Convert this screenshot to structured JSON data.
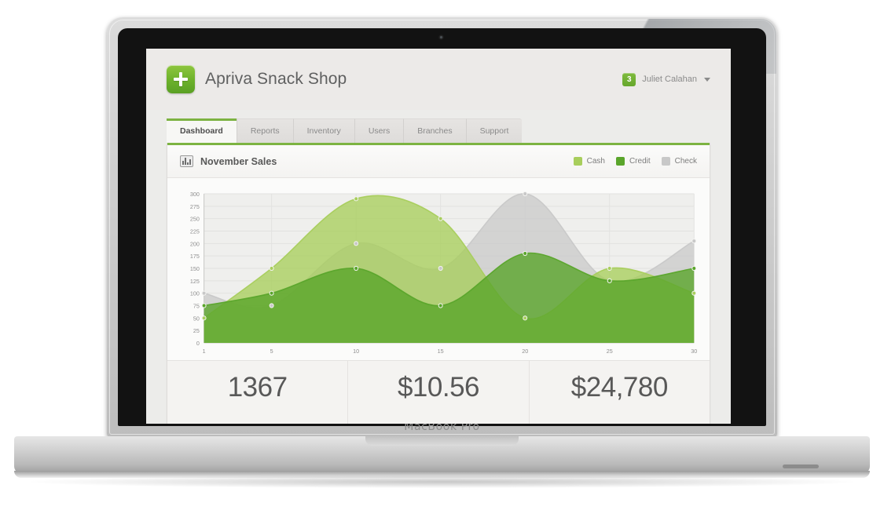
{
  "device": {
    "brand_label": "MacBook Pro"
  },
  "header": {
    "logo_icon": "plus-icon",
    "app_title": "Apriva Snack Shop",
    "notification_count": "3",
    "user_name": "Juliet Calahan",
    "caret_icon": "chevron-down-icon"
  },
  "tabs": [
    {
      "label": "Dashboard",
      "active": true
    },
    {
      "label": "Reports",
      "active": false
    },
    {
      "label": "Inventory",
      "active": false
    },
    {
      "label": "Users",
      "active": false
    },
    {
      "label": "Branches",
      "active": false
    },
    {
      "label": "Support",
      "active": false
    }
  ],
  "panel": {
    "icon": "bar-chart-icon",
    "title": "November Sales",
    "accent_color": "#7cb342"
  },
  "stats": [
    {
      "value": "1367"
    },
    {
      "value": "$10.56"
    },
    {
      "value": "$24,780"
    }
  ],
  "chart_data": {
    "type": "area",
    "title": "November Sales",
    "xlabel": "",
    "ylabel": "",
    "x": [
      1,
      5,
      10,
      15,
      20,
      25,
      30
    ],
    "xticks": [
      "1",
      "5",
      "10",
      "15",
      "20",
      "25",
      "30"
    ],
    "yticks": [
      "0",
      "25",
      "50",
      "75",
      "100",
      "125",
      "150",
      "175",
      "200",
      "225",
      "250",
      "275",
      "300"
    ],
    "xlim": [
      1,
      30
    ],
    "ylim": [
      0,
      300
    ],
    "grid": true,
    "legend_position": "top-right",
    "smoothing": "spline",
    "series": [
      {
        "name": "Cash",
        "color": "#a8ce5c",
        "values": [
          50,
          150,
          290,
          250,
          50,
          150,
          100
        ]
      },
      {
        "name": "Credit",
        "color": "#5aa52b",
        "values": [
          75,
          100,
          150,
          75,
          180,
          125,
          150
        ]
      },
      {
        "name": "Check",
        "color": "#c8c8c8",
        "values": [
          100,
          75,
          200,
          150,
          300,
          125,
          205
        ]
      }
    ]
  }
}
